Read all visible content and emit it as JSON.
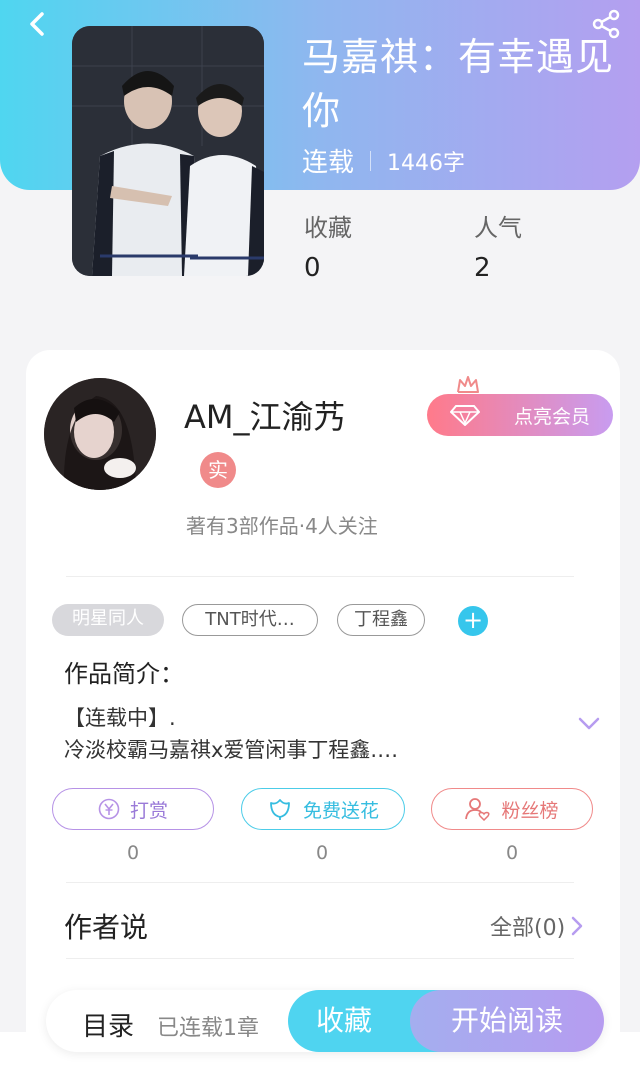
{
  "book": {
    "title": "马嘉祺：有幸遇见你",
    "status": "连载",
    "word_count": "1446字",
    "stats": [
      {
        "label": "收藏",
        "value": "0"
      },
      {
        "label": "人气",
        "value": "2"
      }
    ]
  },
  "author": {
    "name": "AM_江渝艿",
    "real_badge": "实",
    "meta": "著有3部作品·4人关注",
    "vip_button": "点亮会员"
  },
  "tags": [
    "明星同人",
    "TNT时代…",
    "丁程鑫"
  ],
  "tag_add": "+",
  "intro": {
    "title": "作品简介：",
    "line1": "【连载中】.",
    "line2": "冷淡校霸马嘉祺x爱管闲事丁程鑫.…"
  },
  "actions": [
    {
      "label": "打赏",
      "count": "0",
      "icon": "yuan-coin-icon"
    },
    {
      "label": "免费送花",
      "count": "0",
      "icon": "flower-icon"
    },
    {
      "label": "粉丝榜",
      "count": "0",
      "icon": "fan-ranking-icon"
    }
  ],
  "author_says": {
    "title": "作者说",
    "all_link": "全部(0)"
  },
  "bottom_bar": {
    "toc": "目录",
    "chapters": "已连载1章",
    "favorite": "收藏",
    "start_reading": "开始阅读"
  },
  "colors": {
    "header_gradient_start": "#4fd6f0",
    "header_gradient_end": "#b49ff0",
    "accent_cyan": "#4fd4f0",
    "accent_purple": "#b69cf0",
    "badge_red": "#f08a8a"
  }
}
